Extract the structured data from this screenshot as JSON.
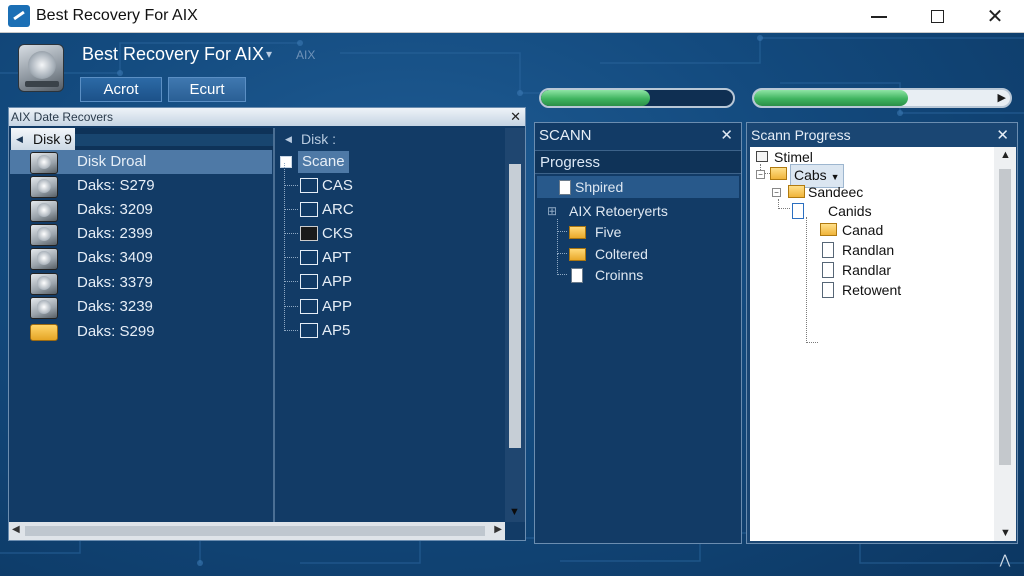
{
  "window": {
    "title": "Best Recovery For AIX"
  },
  "header": {
    "title": "Best Recovery For AIX",
    "subtitle": "AIX",
    "buttons": [
      "Acrot",
      "Ecurt"
    ]
  },
  "progress": {
    "bar1": 0.57,
    "bar2": 0.6
  },
  "left_panel": {
    "title": "AIX Date Recovers",
    "disk_header": "Disk 9",
    "scan_header": "Disk :",
    "disks": [
      {
        "label": "Disk Droal",
        "icon": "hard-disk-icon",
        "selected": true
      },
      {
        "label": "Daks: S279",
        "icon": "hard-disk-icon"
      },
      {
        "label": "Daks: 3209",
        "icon": "hard-disk-icon"
      },
      {
        "label": "Daks: 2399",
        "icon": "hard-disk-icon"
      },
      {
        "label": "Daks: 3409",
        "icon": "hard-disk-icon"
      },
      {
        "label": "Daks: 3379",
        "icon": "hard-disk-icon"
      },
      {
        "label": "Daks: 3239",
        "icon": "hard-disk-icon"
      },
      {
        "label": "Daks: S299",
        "icon": "folder-icon"
      }
    ],
    "tree_root": "Scane",
    "tree_items": [
      {
        "label": "CAS"
      },
      {
        "label": "ARC"
      },
      {
        "label": "CKS"
      },
      {
        "label": "APT"
      },
      {
        "label": "APP"
      },
      {
        "label": "APP"
      },
      {
        "label": "AP5"
      }
    ]
  },
  "mid_panel": {
    "title": "SCANN",
    "subtitle": "Progress",
    "items": [
      {
        "label": "Shpired"
      },
      {
        "label": "AIX Retoeryerts"
      },
      {
        "label": "Five"
      },
      {
        "label": "Coltered"
      },
      {
        "label": "Croinns"
      }
    ]
  },
  "right_panel": {
    "title": "Scann Progress",
    "items": [
      {
        "label": "Stimel"
      },
      {
        "label": "Cabs"
      },
      {
        "label": "Sandeec"
      },
      {
        "label": "Canids"
      },
      {
        "label": "Canad"
      },
      {
        "label": "Randlan"
      },
      {
        "label": "Randlar"
      },
      {
        "label": "Retowent"
      }
    ]
  }
}
